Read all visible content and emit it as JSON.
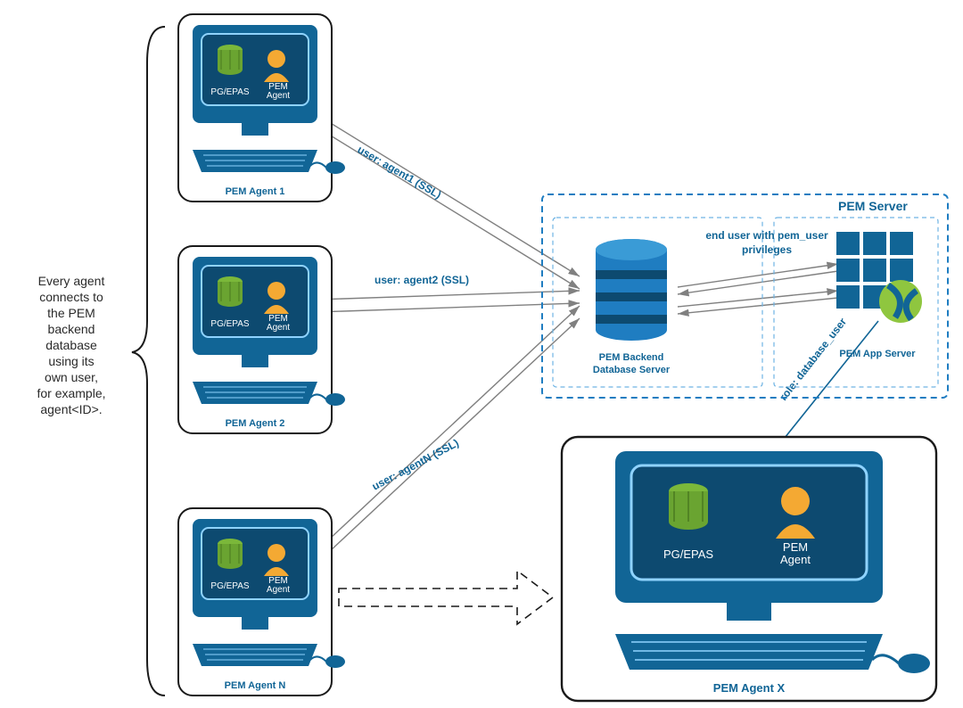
{
  "side_note": {
    "line1": "Every agent",
    "line2": "connects to",
    "line3": "the PEM",
    "line4": "backend",
    "line5": "database",
    "line6": "using its",
    "line7": "own user,",
    "line8": "for example,",
    "line9": "agent<ID>."
  },
  "agents": {
    "a1_caption": "PEM Agent 1",
    "a2_caption": "PEM Agent 2",
    "an_caption": "PEM Agent N",
    "ax_caption": "PEM Agent X",
    "db_label": "PG/EPAS",
    "agent_label_l1": "PEM",
    "agent_label_l2": "Agent"
  },
  "server": {
    "title": "PEM Server",
    "backend_l1": "PEM Backend",
    "backend_l2": "Database Server",
    "app_label": "PEM App Server",
    "privileges_l1": "end user with pem_user",
    "privileges_l2": "privileges"
  },
  "conn": {
    "a1": "user: agent1 (SSL)",
    "a2": "user: agent2 (SSL)",
    "an": "user: agentN (SSL)",
    "role": "role: database_user"
  }
}
